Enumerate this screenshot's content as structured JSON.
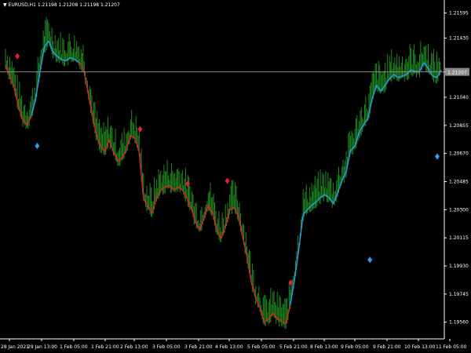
{
  "header": {
    "symbol_line": "▼ EURUSD,H1  1.21198 1.21208 1.21198 1.21207"
  },
  "chart_data": {
    "type": "line",
    "title": "",
    "ylim": [
      1.1945,
      1.2168
    ],
    "y_ticks": [
      "1.21595",
      "1.21430",
      "1.21207",
      "1.21040",
      "1.20855",
      "1.20670",
      "1.20485",
      "1.20300",
      "1.20115",
      "1.19930",
      "1.19745",
      "1.19560"
    ],
    "y_tick_values": [
      1.21595,
      1.2143,
      1.21207,
      1.2104,
      1.20855,
      1.2067,
      1.20485,
      1.203,
      1.20115,
      1.1993,
      1.19745,
      1.1956
    ],
    "current_price": 1.21207,
    "x_ticks": [
      "28 Jan 2021",
      "29 Jan 13:00",
      "1 Feb 05:00",
      "1 Feb 21:00",
      "2 Feb 13:00",
      "3 Feb 05:00",
      "3 Feb 21:00",
      "4 Feb 13:00",
      "5 Feb 05:00",
      "5 Feb 21:00",
      "8 Feb 13:00",
      "9 Feb 05:00",
      "9 Feb 21:00",
      "10 Feb 13:00",
      "11 Feb 05:00"
    ],
    "series_values": [
      1.2125,
      1.2118,
      1.211,
      1.2098,
      1.2089,
      1.2086,
      1.2092,
      1.2103,
      1.2121,
      1.2137,
      1.2141,
      1.2134,
      1.2131,
      1.2129,
      1.2128,
      1.213,
      1.2129,
      1.2127,
      1.2124,
      1.2109,
      1.2094,
      1.208,
      1.2072,
      1.2068,
      1.2076,
      1.2068,
      1.2062,
      1.2064,
      1.2069,
      1.2079,
      1.2077,
      1.2068,
      1.2038,
      1.2032,
      1.2028,
      1.2038,
      1.2043,
      1.2045,
      1.2046,
      1.2043,
      1.2045,
      1.2043,
      1.2038,
      1.2032,
      1.2022,
      1.2017,
      1.2024,
      1.2033,
      1.2028,
      1.2016,
      1.2011,
      1.2019,
      1.203,
      1.2032,
      1.2026,
      1.2012,
      1.1999,
      1.1982,
      1.1972,
      1.1965,
      1.1956,
      1.1958,
      1.1962,
      1.1958,
      1.1957,
      1.1955,
      1.1967,
      1.1984,
      1.2004,
      1.2027,
      1.203,
      1.2033,
      1.2035,
      1.2038,
      1.204,
      1.2038,
      1.2034,
      1.2041,
      1.2049,
      1.2055,
      1.2069,
      1.2072,
      1.2081,
      1.2086,
      1.209,
      1.2103,
      1.2112,
      1.2108,
      1.2112,
      1.2116,
      1.2119,
      1.2117,
      1.2118,
      1.2119,
      1.2122,
      1.2121,
      1.2121,
      1.2127,
      1.2123,
      1.2118,
      1.2117,
      1.2122
    ],
    "series_colors": [
      "#2a9df4",
      "#e02030",
      "#e02030",
      "#e02030",
      "#e02030",
      "#e02030",
      "#e02030",
      "#2a9df4",
      "#2a9df4",
      "#2a9df4",
      "#2a9df4",
      "#2a9df4",
      "#2a9df4",
      "#2a9df4",
      "#2a9df4",
      "#2a9df4",
      "#2a9df4",
      "#2a9df4",
      "#e02030",
      "#e02030",
      "#e02030",
      "#e02030",
      "#e02030",
      "#e02030",
      "#e02030",
      "#e02030",
      "#e02030",
      "#e02030",
      "#e02030",
      "#e02030",
      "#e02030",
      "#e02030",
      "#e02030",
      "#e02030",
      "#e02030",
      "#e02030",
      "#e02030",
      "#e02030",
      "#e02030",
      "#e02030",
      "#e02030",
      "#e02030",
      "#e02030",
      "#e02030",
      "#e02030",
      "#e02030",
      "#e02030",
      "#e02030",
      "#e02030",
      "#e02030",
      "#e02030",
      "#e02030",
      "#e02030",
      "#e02030",
      "#e02030",
      "#e02030",
      "#e02030",
      "#e02030",
      "#e02030",
      "#e02030",
      "#e02030",
      "#e02030",
      "#e02030",
      "#e02030",
      "#e02030",
      "#e02030",
      "#e02030",
      "#2a9df4",
      "#2a9df4",
      "#2a9df4",
      "#2a9df4",
      "#2a9df4",
      "#2a9df4",
      "#2a9df4",
      "#2a9df4",
      "#2a9df4",
      "#2a9df4",
      "#2a9df4",
      "#2a9df4",
      "#2a9df4",
      "#2a9df4",
      "#2a9df4",
      "#2a9df4",
      "#2a9df4",
      "#2a9df4",
      "#2a9df4",
      "#2a9df4",
      "#2a9df4",
      "#2a9df4",
      "#2a9df4",
      "#2a9df4",
      "#2a9df4",
      "#2a9df4",
      "#2a9df4",
      "#2a9df4",
      "#2a9df4",
      "#2a9df4",
      "#2a9df4",
      "#2a9df4",
      "#2a9df4",
      "#2a9df4",
      "#2a9df4"
    ],
    "bar_color": "#1f8a1f",
    "signals": [
      {
        "i": 3,
        "price": 1.2131,
        "color": "#e02030"
      },
      {
        "i": 8,
        "price": 1.2072,
        "color": "#2a9df4"
      },
      {
        "i": 34,
        "price": 1.2083,
        "color": "#e02030"
      },
      {
        "i": 46,
        "price": 1.2047,
        "color": "#e02030"
      },
      {
        "i": 56,
        "price": 1.2049,
        "color": "#e02030"
      },
      {
        "i": 72,
        "price": 1.1982,
        "color": "#e02030"
      },
      {
        "i": 92,
        "price": 1.1997,
        "color": "#2a9df4"
      },
      {
        "i": 109,
        "price": 1.2065,
        "color": "#2a9df4"
      }
    ],
    "price_line_color": "#8a8a8a",
    "grid": false
  }
}
